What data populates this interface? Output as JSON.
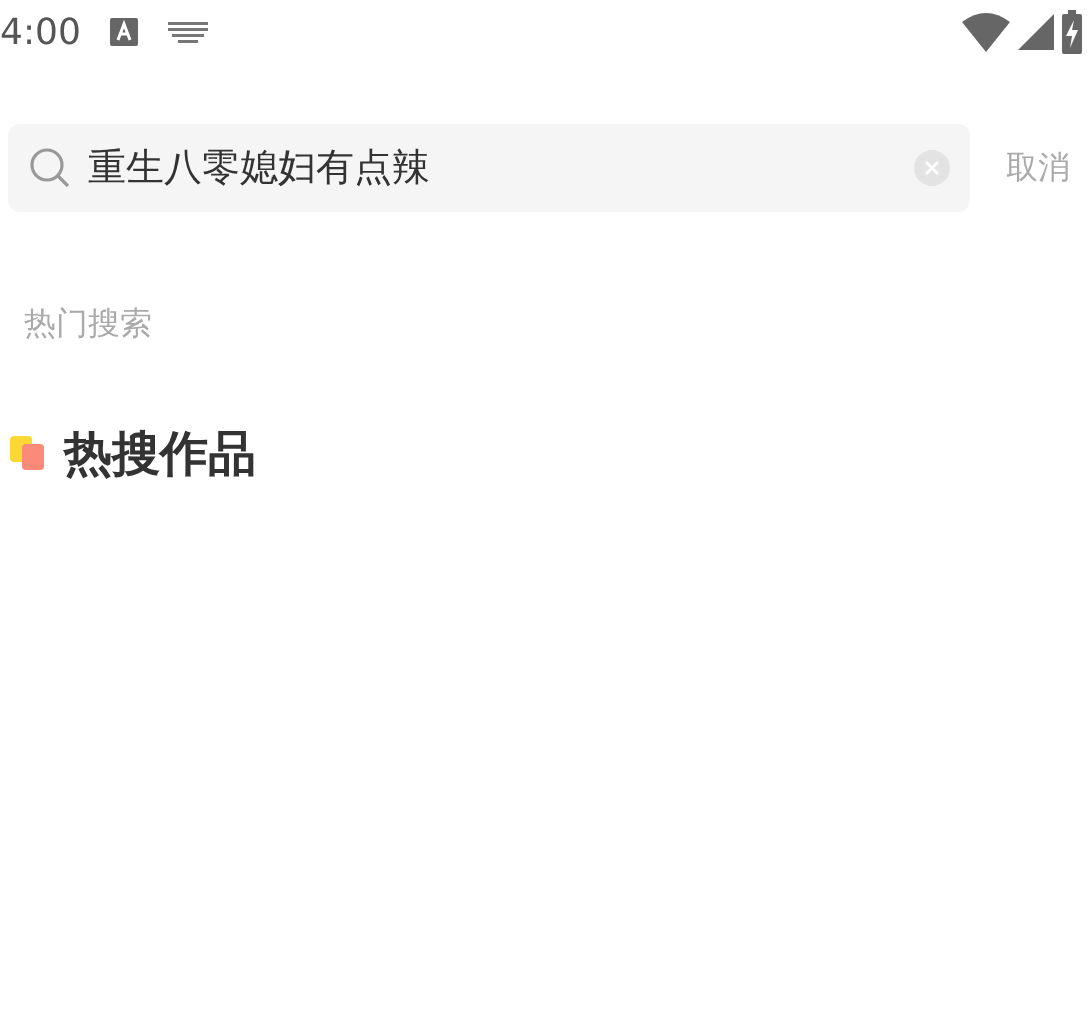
{
  "status_bar": {
    "time": "4:00"
  },
  "search": {
    "value": "重生八零媳妇有点辣",
    "cancel": "取消"
  },
  "hot_search": {
    "title": "热门搜索"
  },
  "section": {
    "title": "热搜作品"
  }
}
